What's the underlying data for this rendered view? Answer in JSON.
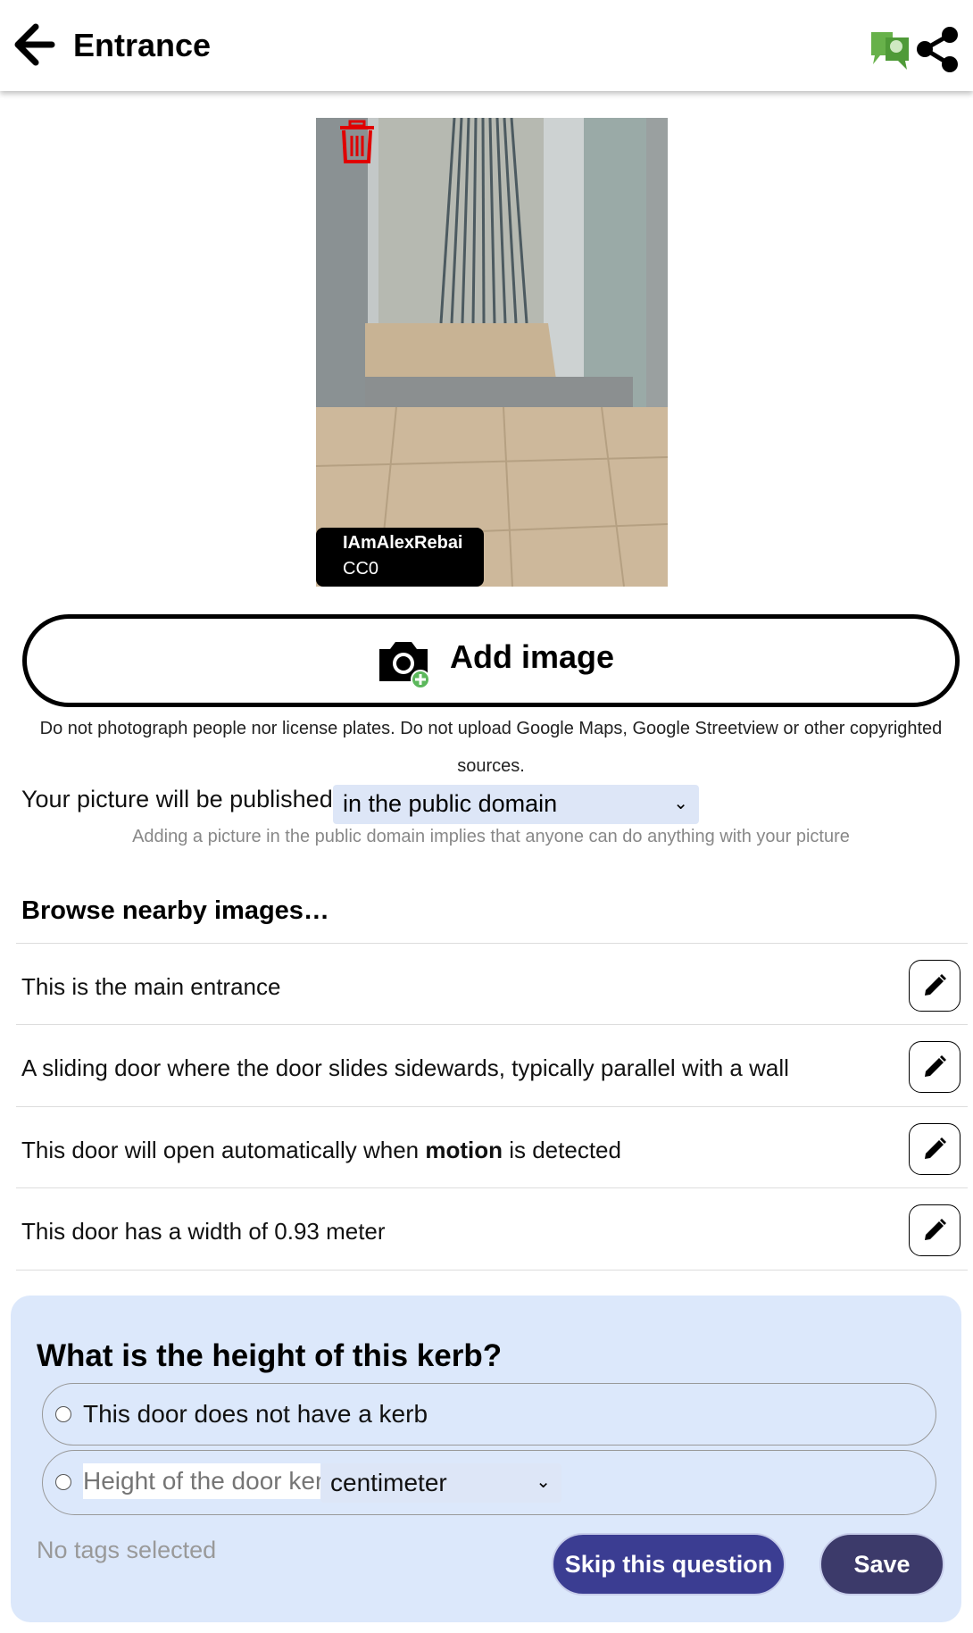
{
  "header": {
    "title": "Entrance",
    "icons": [
      "back-arrow-icon",
      "speech-bubbles-icon",
      "share-icon"
    ]
  },
  "image": {
    "author": "IAmAlexRebai",
    "license": "CC0"
  },
  "add_image": {
    "label": "Add image"
  },
  "notice": {
    "line1": "Do not photograph people nor license plates. Do not upload Google Maps, Google Streetview or other copyrighted",
    "line2": "sources."
  },
  "publish": {
    "label": "Your picture will be published",
    "selected": "in the public domain",
    "hint": "Adding a picture in the public domain implies that anyone can do anything with your picture"
  },
  "browse": {
    "label": "Browse nearby images…"
  },
  "attributes": [
    {
      "text": "This is the main entrance"
    },
    {
      "text": "A sliding door where the door slides sidewards, typically parallel with a wall"
    },
    {
      "pre": "This door will open automatically when ",
      "bold": "motion",
      "post": " is detected"
    },
    {
      "text": "This door has a width of 0.93 meter"
    }
  ],
  "question": {
    "title": "What is the height of this kerb?",
    "option1": "This door does not have a kerb",
    "height_placeholder": "Height of the door kerb",
    "unit_selected": "centimeter",
    "no_tags": "No tags selected",
    "skip_label": "Skip this question",
    "save_label": "Save"
  },
  "colors": {
    "accent": "#3b3d92",
    "question_bg": "#dce8fb",
    "trash": "#e00000",
    "select_bg": "#dde6f7"
  }
}
